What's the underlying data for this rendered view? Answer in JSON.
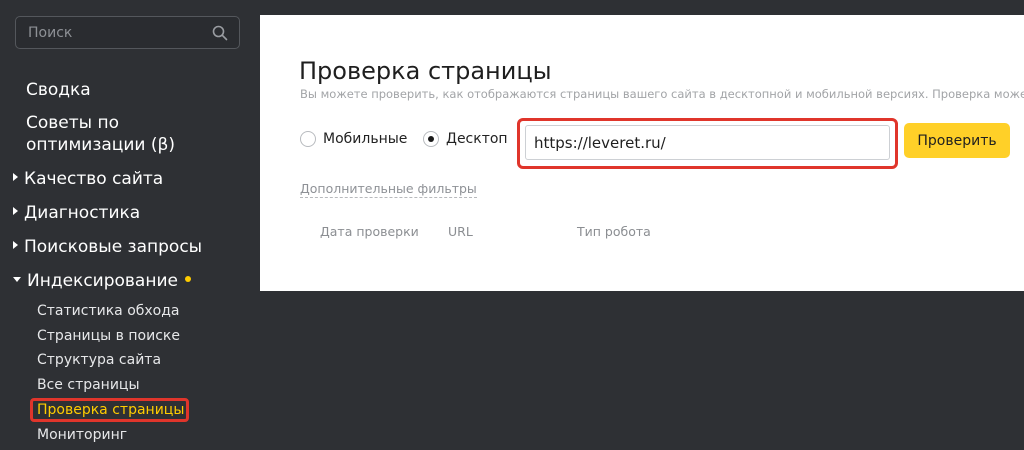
{
  "sidebar": {
    "search": {
      "placeholder": "Поиск",
      "icon": "search-icon"
    },
    "items": [
      {
        "label": "Сводка"
      },
      {
        "label": "Советы по оптимизации (β)"
      },
      {
        "label": "Качество сайта",
        "expandable": true,
        "expanded": false
      },
      {
        "label": "Диагностика",
        "expandable": true,
        "expanded": false
      },
      {
        "label": "Поисковые запросы",
        "expandable": true,
        "expanded": false
      },
      {
        "label": "Индексирование",
        "expandable": true,
        "expanded": true,
        "has_badge": true
      }
    ],
    "subitems": [
      {
        "label": "Статистика обхода"
      },
      {
        "label": "Страницы в поиске"
      },
      {
        "label": "Структура сайта"
      },
      {
        "label": "Все страницы"
      },
      {
        "label": "Проверка страницы",
        "active": true
      },
      {
        "label": "Мониторинг"
      }
    ]
  },
  "main": {
    "title": "Проверка страницы",
    "subtitle": "Вы можете проверить, как отображаются страницы вашего сайта в десктопной и мобильной версиях. Проверка может зан",
    "radios": [
      {
        "label": "Мобильные",
        "checked": false
      },
      {
        "label": "Десктоп",
        "checked": true
      }
    ],
    "url_input": {
      "value": "https://leveret.ru/"
    },
    "check_button": "Проверить",
    "filters_link": "Дополнительные фильтры",
    "columns": [
      "Дата проверки",
      "URL",
      "Тип робота"
    ]
  },
  "colors": {
    "background": "#2e3034",
    "accent": "#ffcc00",
    "button": "#ffd028",
    "highlight": "#e0352b"
  }
}
